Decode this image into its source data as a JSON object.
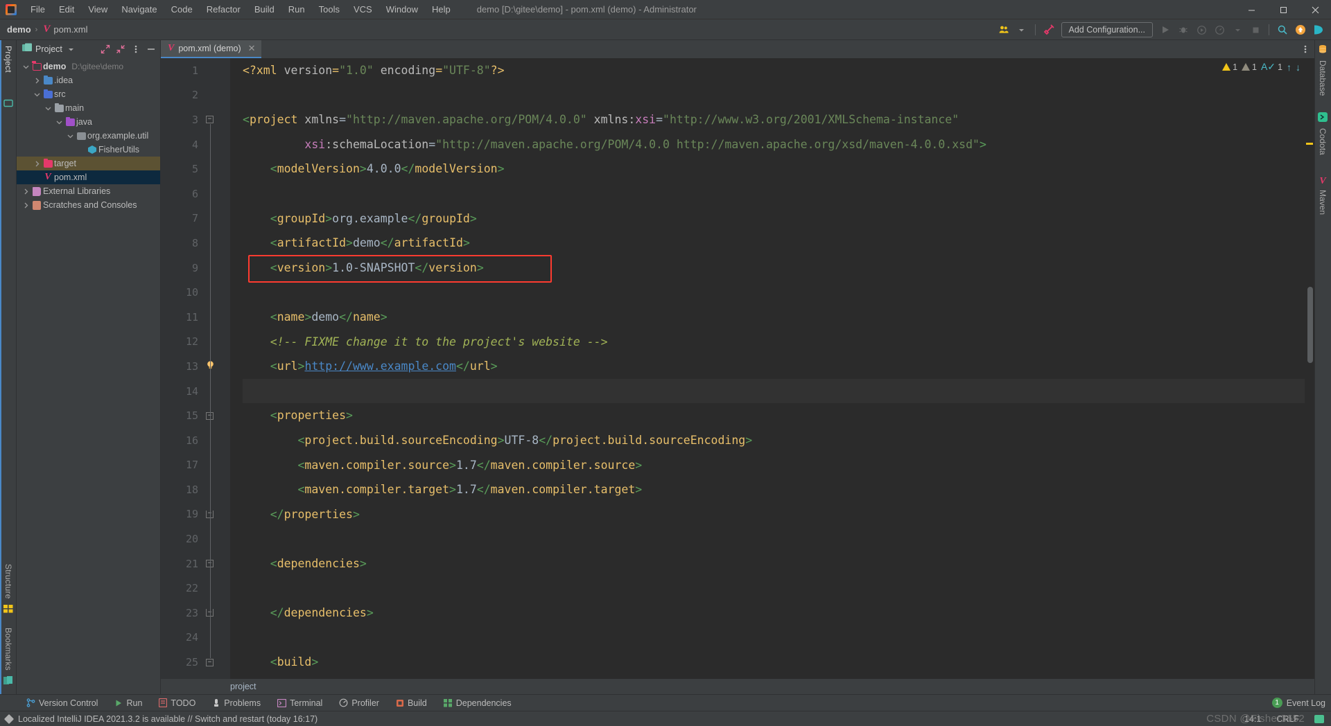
{
  "window": {
    "title": "demo [D:\\gitee\\demo] - pom.xml (demo) - Administrator",
    "minimize": "─",
    "maximize": "☐",
    "close": "✕"
  },
  "menu": {
    "items": [
      "File",
      "Edit",
      "View",
      "Navigate",
      "Code",
      "Refactor",
      "Build",
      "Run",
      "Tools",
      "VCS",
      "Window",
      "Help"
    ]
  },
  "navbar": {
    "crumb_project": "demo",
    "crumb_sep": "›",
    "crumb_file": "pom.xml",
    "add_configuration": "Add Configuration...",
    "icons": [
      "people-icon",
      "build-hammer-icon",
      "run-icon",
      "debug-icon",
      "run-with-coverage-icon",
      "profile-icon",
      "chevron-down-icon",
      "stop-icon",
      "search-icon",
      "update-icon",
      "codota-icon"
    ]
  },
  "left_rail": {
    "top": [
      {
        "label": "Project",
        "icon": "project-icon",
        "active": true
      },
      {
        "label": "",
        "icon": "commit-icon",
        "active": false
      }
    ],
    "bottom": [
      {
        "label": "Structure",
        "icon": "structure-icon"
      },
      {
        "label": "Bookmarks",
        "icon": "bookmarks-icon"
      }
    ]
  },
  "right_rail": {
    "items": [
      {
        "label": "Database",
        "icon": "database-icon"
      },
      {
        "label": "Codota",
        "icon": "codota-icon"
      },
      {
        "label": "Maven",
        "icon": "maven-icon"
      }
    ]
  },
  "project_panel": {
    "title": "Project",
    "header_icons": [
      "expand-all-icon",
      "collapse-all-icon",
      "options-menu-icon",
      "hide-icon"
    ],
    "tree": [
      {
        "depth": 0,
        "arrow": "⌄",
        "icon": "folder-project-icon",
        "label": "demo",
        "bold": true,
        "path": "D:\\gitee\\demo",
        "state": "normal"
      },
      {
        "depth": 1,
        "arrow": "›",
        "icon": "folder-idea-icon",
        "label": ".idea",
        "bold": false,
        "path": "",
        "state": "normal"
      },
      {
        "depth": 1,
        "arrow": "⌄",
        "icon": "folder-src-icon",
        "label": "src",
        "bold": false,
        "path": "",
        "state": "normal"
      },
      {
        "depth": 2,
        "arrow": "⌄",
        "icon": "folder-icon",
        "label": "main",
        "bold": false,
        "path": "",
        "state": "normal"
      },
      {
        "depth": 3,
        "arrow": "⌄",
        "icon": "folder-java-icon",
        "label": "java",
        "bold": false,
        "path": "",
        "state": "normal"
      },
      {
        "depth": 4,
        "arrow": "⌄",
        "icon": "package-icon",
        "label": "org.example.util",
        "bold": false,
        "path": "",
        "state": "normal"
      },
      {
        "depth": 5,
        "arrow": "",
        "icon": "class-icon",
        "label": "FisherUtils",
        "bold": false,
        "path": "",
        "state": "normal"
      },
      {
        "depth": 1,
        "arrow": "›",
        "icon": "folder-target-icon",
        "label": "target",
        "bold": false,
        "path": "",
        "state": "target"
      },
      {
        "depth": 1,
        "arrow": "",
        "icon": "maven-file-icon",
        "label": "pom.xml",
        "bold": false,
        "path": "",
        "state": "selected"
      },
      {
        "depth": 0,
        "arrow": "›",
        "icon": "external-libraries-icon",
        "label": "External Libraries",
        "bold": false,
        "path": "",
        "state": "normal"
      },
      {
        "depth": 0,
        "arrow": "›",
        "icon": "scratches-icon",
        "label": "Scratches and Consoles",
        "bold": false,
        "path": "",
        "state": "normal"
      }
    ]
  },
  "editor": {
    "tab": {
      "label": "pom.xml (demo)",
      "icon": "maven-file-icon",
      "close": "✕"
    },
    "breadcrumb": "project",
    "inspections": {
      "warnings": "1",
      "weak_warnings": "1",
      "typos": "1",
      "up_arrow": "↑",
      "down_arrow": "↓"
    },
    "lines": [
      {
        "n": 1,
        "fold": "",
        "bulb": false,
        "tokens": [
          {
            "t": "prolog",
            "s": "<?xml "
          },
          {
            "t": "attr",
            "s": "version"
          },
          {
            "t": "prolog",
            "s": "="
          },
          {
            "t": "str",
            "s": "\"1.0\""
          },
          {
            "t": "txt",
            "s": " "
          },
          {
            "t": "attr",
            "s": "encoding"
          },
          {
            "t": "prolog",
            "s": "="
          },
          {
            "t": "str",
            "s": "\"UTF-8\""
          },
          {
            "t": "prolog",
            "s": "?>"
          }
        ]
      },
      {
        "n": 2,
        "fold": "",
        "bulb": false,
        "tokens": []
      },
      {
        "n": 3,
        "fold": "start",
        "bulb": false,
        "tokens": [
          {
            "t": "brk",
            "s": "<"
          },
          {
            "t": "tag",
            "s": "project"
          },
          {
            "t": "txt",
            "s": " "
          },
          {
            "t": "attr",
            "s": "xmlns"
          },
          {
            "t": "txt",
            "s": "="
          },
          {
            "t": "str",
            "s": "\"http://maven.apache.org/POM/4.0.0\""
          },
          {
            "t": "txt",
            "s": " "
          },
          {
            "t": "attr",
            "s": "xmlns:"
          },
          {
            "t": "ns",
            "s": "xsi"
          },
          {
            "t": "txt",
            "s": "="
          },
          {
            "t": "str",
            "s": "\"http://www.w3.org/2001/XMLSchema-instance\""
          }
        ]
      },
      {
        "n": 4,
        "fold": "",
        "bulb": false,
        "tokens": [
          {
            "t": "txt",
            "s": "         "
          },
          {
            "t": "ns",
            "s": "xsi"
          },
          {
            "t": "attr",
            "s": ":schemaLocation"
          },
          {
            "t": "txt",
            "s": "="
          },
          {
            "t": "str",
            "s": "\"http://maven.apache.org/POM/4.0.0 http://maven.apache.org/xsd/maven-4.0.0.xsd\""
          },
          {
            "t": "brk",
            "s": ">"
          }
        ]
      },
      {
        "n": 5,
        "fold": "",
        "bulb": false,
        "tokens": [
          {
            "t": "txt",
            "s": "    "
          },
          {
            "t": "brk",
            "s": "<"
          },
          {
            "t": "tag",
            "s": "modelVersion"
          },
          {
            "t": "brk",
            "s": ">"
          },
          {
            "t": "val",
            "s": "4.0.0"
          },
          {
            "t": "brk",
            "s": "</"
          },
          {
            "t": "tag",
            "s": "modelVersion"
          },
          {
            "t": "brk",
            "s": ">"
          }
        ]
      },
      {
        "n": 6,
        "fold": "",
        "bulb": false,
        "tokens": []
      },
      {
        "n": 7,
        "fold": "",
        "bulb": false,
        "tokens": [
          {
            "t": "txt",
            "s": "    "
          },
          {
            "t": "brk",
            "s": "<"
          },
          {
            "t": "tag",
            "s": "groupId"
          },
          {
            "t": "brk",
            "s": ">"
          },
          {
            "t": "val",
            "s": "org.example"
          },
          {
            "t": "brk",
            "s": "</"
          },
          {
            "t": "tag",
            "s": "groupId"
          },
          {
            "t": "brk",
            "s": ">"
          }
        ]
      },
      {
        "n": 8,
        "fold": "",
        "bulb": false,
        "tokens": [
          {
            "t": "txt",
            "s": "    "
          },
          {
            "t": "brk",
            "s": "<"
          },
          {
            "t": "tag",
            "s": "artifactId"
          },
          {
            "t": "brk",
            "s": ">"
          },
          {
            "t": "val",
            "s": "demo"
          },
          {
            "t": "brk",
            "s": "</"
          },
          {
            "t": "tag",
            "s": "artifactId"
          },
          {
            "t": "brk",
            "s": ">"
          }
        ]
      },
      {
        "n": 9,
        "fold": "",
        "bulb": false,
        "tokens": [
          {
            "t": "txt",
            "s": "    "
          },
          {
            "t": "brk",
            "s": "<"
          },
          {
            "t": "tag",
            "s": "version"
          },
          {
            "t": "brk",
            "s": ">"
          },
          {
            "t": "val",
            "s": "1.0-SNAPSHOT"
          },
          {
            "t": "brk",
            "s": "</"
          },
          {
            "t": "tag",
            "s": "version"
          },
          {
            "t": "brk",
            "s": ">"
          }
        ]
      },
      {
        "n": 10,
        "fold": "",
        "bulb": false,
        "tokens": []
      },
      {
        "n": 11,
        "fold": "",
        "bulb": false,
        "tokens": [
          {
            "t": "txt",
            "s": "    "
          },
          {
            "t": "brk",
            "s": "<"
          },
          {
            "t": "tag",
            "s": "name"
          },
          {
            "t": "brk",
            "s": ">"
          },
          {
            "t": "val",
            "s": "demo"
          },
          {
            "t": "brk",
            "s": "</"
          },
          {
            "t": "tag",
            "s": "name"
          },
          {
            "t": "brk",
            "s": ">"
          }
        ]
      },
      {
        "n": 12,
        "fold": "",
        "bulb": false,
        "tokens": [
          {
            "t": "txt",
            "s": "    "
          },
          {
            "t": "comment",
            "s": "<!-- FIXME change it to the project's website -->"
          }
        ]
      },
      {
        "n": 13,
        "fold": "",
        "bulb": true,
        "tokens": [
          {
            "t": "txt",
            "s": "    "
          },
          {
            "t": "brk",
            "s": "<"
          },
          {
            "t": "tag",
            "s": "url"
          },
          {
            "t": "brk",
            "s": ">"
          },
          {
            "t": "link",
            "s": "http://www.example.com"
          },
          {
            "t": "brk",
            "s": "</"
          },
          {
            "t": "tag",
            "s": "url"
          },
          {
            "t": "brk",
            "s": ">"
          }
        ]
      },
      {
        "n": 14,
        "fold": "",
        "bulb": false,
        "active": true,
        "tokens": []
      },
      {
        "n": 15,
        "fold": "start",
        "bulb": false,
        "tokens": [
          {
            "t": "txt",
            "s": "    "
          },
          {
            "t": "brk",
            "s": "<"
          },
          {
            "t": "tag",
            "s": "properties"
          },
          {
            "t": "brk",
            "s": ">"
          }
        ]
      },
      {
        "n": 16,
        "fold": "",
        "bulb": false,
        "tokens": [
          {
            "t": "txt",
            "s": "        "
          },
          {
            "t": "brk",
            "s": "<"
          },
          {
            "t": "tag",
            "s": "project.build.sourceEncoding"
          },
          {
            "t": "brk",
            "s": ">"
          },
          {
            "t": "val",
            "s": "UTF-8"
          },
          {
            "t": "brk",
            "s": "</"
          },
          {
            "t": "tag",
            "s": "project.build.sourceEncoding"
          },
          {
            "t": "brk",
            "s": ">"
          }
        ]
      },
      {
        "n": 17,
        "fold": "",
        "bulb": false,
        "tokens": [
          {
            "t": "txt",
            "s": "        "
          },
          {
            "t": "brk",
            "s": "<"
          },
          {
            "t": "tag",
            "s": "maven.compiler.source"
          },
          {
            "t": "brk",
            "s": ">"
          },
          {
            "t": "val",
            "s": "1.7"
          },
          {
            "t": "brk",
            "s": "</"
          },
          {
            "t": "tag",
            "s": "maven.compiler.source"
          },
          {
            "t": "brk",
            "s": ">"
          }
        ]
      },
      {
        "n": 18,
        "fold": "",
        "bulb": false,
        "tokens": [
          {
            "t": "txt",
            "s": "        "
          },
          {
            "t": "brk",
            "s": "<"
          },
          {
            "t": "tag",
            "s": "maven.compiler.target"
          },
          {
            "t": "brk",
            "s": ">"
          },
          {
            "t": "val",
            "s": "1.7"
          },
          {
            "t": "brk",
            "s": "</"
          },
          {
            "t": "tag",
            "s": "maven.compiler.target"
          },
          {
            "t": "brk",
            "s": ">"
          }
        ]
      },
      {
        "n": 19,
        "fold": "end",
        "bulb": false,
        "tokens": [
          {
            "t": "txt",
            "s": "    "
          },
          {
            "t": "brk",
            "s": "</"
          },
          {
            "t": "tag",
            "s": "properties"
          },
          {
            "t": "brk",
            "s": ">"
          }
        ]
      },
      {
        "n": 20,
        "fold": "",
        "bulb": false,
        "tokens": []
      },
      {
        "n": 21,
        "fold": "start",
        "bulb": false,
        "tokens": [
          {
            "t": "txt",
            "s": "    "
          },
          {
            "t": "brk",
            "s": "<"
          },
          {
            "t": "tag",
            "s": "dependencies"
          },
          {
            "t": "brk",
            "s": ">"
          }
        ]
      },
      {
        "n": 22,
        "fold": "",
        "bulb": false,
        "tokens": []
      },
      {
        "n": 23,
        "fold": "end",
        "bulb": false,
        "tokens": [
          {
            "t": "txt",
            "s": "    "
          },
          {
            "t": "brk",
            "s": "</"
          },
          {
            "t": "tag",
            "s": "dependencies"
          },
          {
            "t": "brk",
            "s": ">"
          }
        ]
      },
      {
        "n": 24,
        "fold": "",
        "bulb": false,
        "tokens": []
      },
      {
        "n": 25,
        "fold": "start",
        "bulb": false,
        "tokens": [
          {
            "t": "txt",
            "s": "    "
          },
          {
            "t": "brk",
            "s": "<"
          },
          {
            "t": "tag",
            "s": "build"
          },
          {
            "t": "brk",
            "s": ">"
          }
        ]
      }
    ]
  },
  "tool_window_bar": {
    "items": [
      {
        "label": "Version Control",
        "icon": "branch-icon"
      },
      {
        "label": "Run",
        "icon": "run-icon"
      },
      {
        "label": "TODO",
        "icon": "todo-icon"
      },
      {
        "label": "Problems",
        "icon": "problems-icon"
      },
      {
        "label": "Terminal",
        "icon": "terminal-icon"
      },
      {
        "label": "Profiler",
        "icon": "profiler-icon"
      },
      {
        "label": "Build",
        "icon": "build-icon"
      },
      {
        "label": "Dependencies",
        "icon": "dependencies-icon"
      }
    ],
    "event_log": {
      "label": "Event Log",
      "count": "1"
    }
  },
  "statusbar": {
    "message": "Localized IntelliJ IDEA 2021.3.2 is available // Switch and restart (today 16:17)",
    "caret": "14:1",
    "line_separator": "CRLF",
    "watermark": "CSDN @Fisher3652"
  }
}
